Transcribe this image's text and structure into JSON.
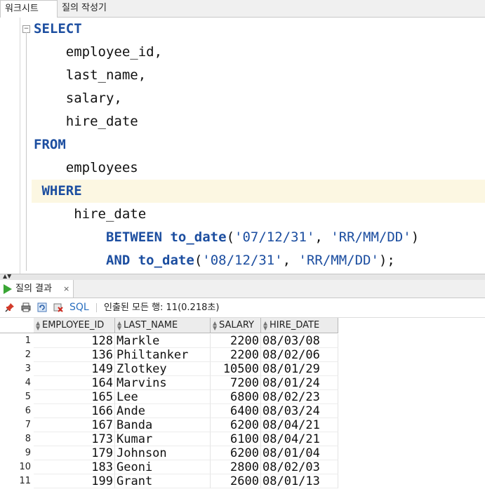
{
  "tabs": {
    "worksheet": "워크시트",
    "query_builder": "질의 작성기"
  },
  "editor": {
    "lines": [
      [
        {
          "t": "SELECT",
          "k": "kw"
        }
      ],
      [
        {
          "t": "    employee_id,"
        }
      ],
      [
        {
          "t": "    last_name,"
        }
      ],
      [
        {
          "t": "    salary,"
        }
      ],
      [
        {
          "t": "    hire_date"
        }
      ],
      [
        {
          "t": "FROM",
          "k": "kw"
        }
      ],
      [
        {
          "t": "    employees"
        }
      ],
      [
        {
          "t": " WHERE",
          "k": "kw"
        }
      ],
      [
        {
          "t": "     hire_date"
        }
      ],
      [
        {
          "t": "         "
        },
        {
          "t": "BETWEEN",
          "k": "kw"
        },
        {
          "t": " "
        },
        {
          "t": "to_date",
          "k": "kw"
        },
        {
          "t": "("
        },
        {
          "t": "'07/12/31'",
          "k": "str"
        },
        {
          "t": ", "
        },
        {
          "t": "'RR/MM/DD'",
          "k": "str"
        },
        {
          "t": ")"
        }
      ],
      [
        {
          "t": "         "
        },
        {
          "t": "AND",
          "k": "kw"
        },
        {
          "t": " "
        },
        {
          "t": "to_date",
          "k": "kw"
        },
        {
          "t": "("
        },
        {
          "t": "'08/12/31'",
          "k": "str"
        },
        {
          "t": ", "
        },
        {
          "t": "'RR/MM/DD'",
          "k": "str"
        },
        {
          "t": ");"
        }
      ]
    ]
  },
  "results": {
    "tab_label": "질의 결과",
    "tab_close": "×",
    "sql_label": "SQL",
    "fetch_status": "인출된 모든 행: 11(0.218초)",
    "columns": [
      "EMPLOYEE_ID",
      "LAST_NAME",
      "SALARY",
      "HIRE_DATE"
    ],
    "rows": [
      [
        "1",
        "128",
        "Markle",
        "2200",
        "08/03/08"
      ],
      [
        "2",
        "136",
        "Philtanker",
        "2200",
        "08/02/06"
      ],
      [
        "3",
        "149",
        "Zlotkey",
        "10500",
        "08/01/29"
      ],
      [
        "4",
        "164",
        "Marvins",
        "7200",
        "08/01/24"
      ],
      [
        "5",
        "165",
        "Lee",
        "6800",
        "08/02/23"
      ],
      [
        "6",
        "166",
        "Ande",
        "6400",
        "08/03/24"
      ],
      [
        "7",
        "167",
        "Banda",
        "6200",
        "08/04/21"
      ],
      [
        "8",
        "173",
        "Kumar",
        "6100",
        "08/04/21"
      ],
      [
        "9",
        "179",
        "Johnson",
        "6200",
        "08/01/04"
      ],
      [
        "10",
        "183",
        "Geoni",
        "2800",
        "08/02/03"
      ],
      [
        "11",
        "199",
        "Grant",
        "2600",
        "08/01/13"
      ]
    ]
  },
  "colors": {
    "keyword": "#1c4ea0",
    "run_icon": "#3aa635",
    "current_line": "#fcf7e2"
  },
  "icons": [
    "pin-icon",
    "print-icon",
    "refresh-icon",
    "delete-icon",
    "run-icon",
    "sort-icon",
    "fold-icon"
  ]
}
